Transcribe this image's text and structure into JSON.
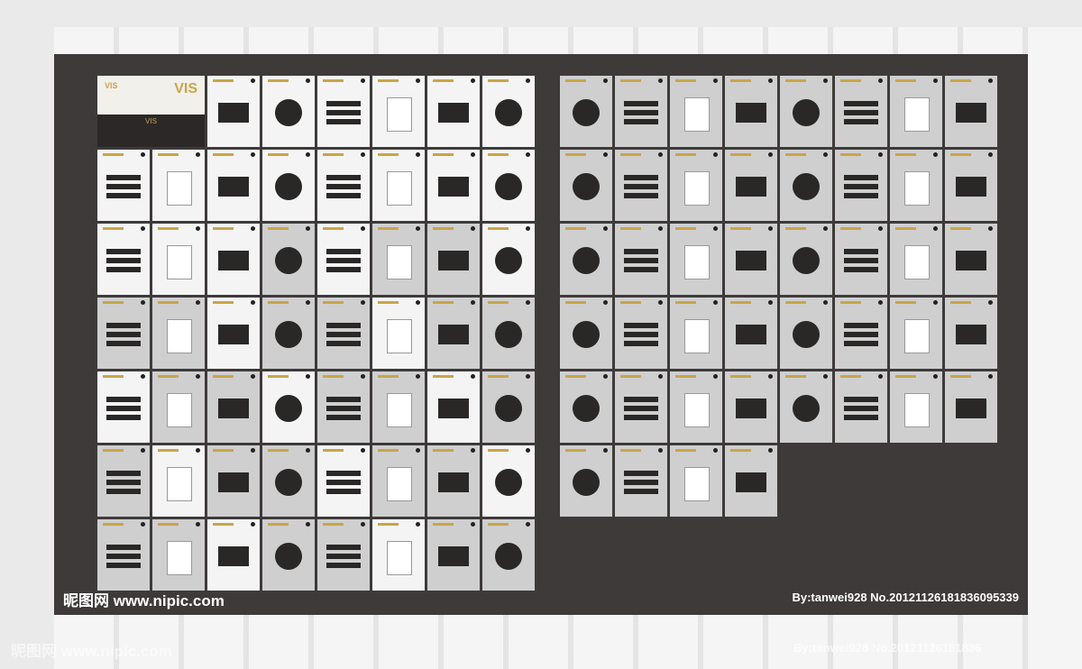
{
  "cover": {
    "vis_small": "VIS",
    "vis_big": "VIS",
    "vis_mid": "VIS"
  },
  "watermark": {
    "site_primary": "昵图网 www.nipic.com",
    "credit_primary": "By:tanwei928  No.20121126181836095339",
    "site_secondary": "昵图网 www.nipic.com",
    "credit_secondary": "By:tanwei928  No.20121126181836"
  },
  "colors": {
    "board": "#3e3a3a",
    "gold": "#c9a54a",
    "page": "#f4f4f4",
    "page_gray": "#cfcfcf"
  }
}
